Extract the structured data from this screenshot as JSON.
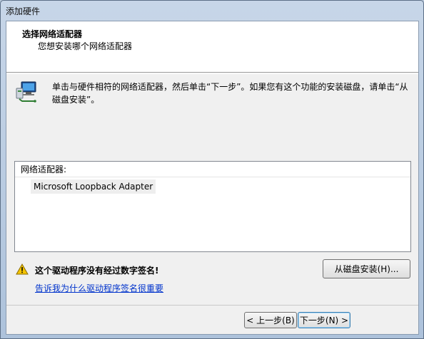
{
  "window": {
    "title": "添加硬件"
  },
  "header": {
    "title": "选择网络适配器",
    "subtitle": "您想安装哪个网络适配器"
  },
  "instruction": "单击与硬件相符的网络适配器，然后单击“下一步”。如果您有这个功能的安装磁盘，请单击“从磁盘安装”。",
  "adapter_list": {
    "header": "网络适配器:",
    "items": [
      "Microsoft Loopback Adapter"
    ]
  },
  "warning": {
    "text": "这个驱动程序没有经过数字签名!",
    "link": "告诉我为什么驱动程序签名很重要"
  },
  "buttons": {
    "have_disk": "从磁盘安装(H)...",
    "back": "< 上一步(B)",
    "next": "下一步(N) >"
  },
  "colors": {
    "link": "#0033cc",
    "warning_icon": "#f5c400",
    "header_bg": "#ffffff",
    "client_bg": "#f0f0f0"
  }
}
